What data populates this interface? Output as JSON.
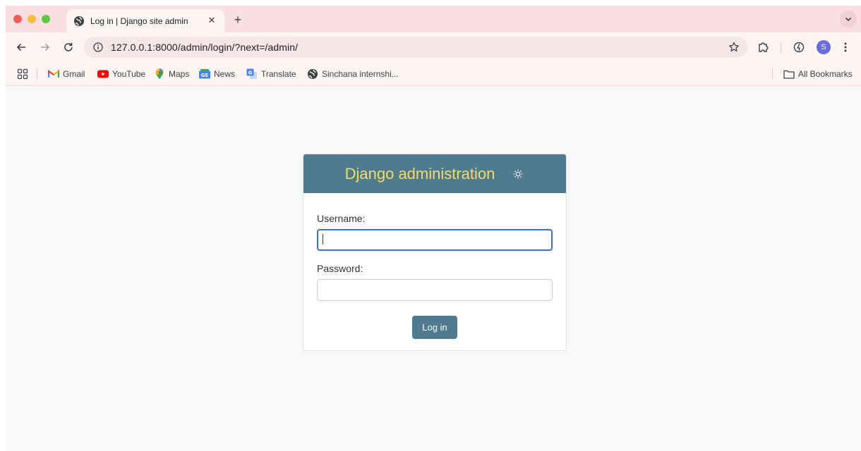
{
  "browser": {
    "tab": {
      "title": "Log in | Django site admin",
      "favicon": "globe-icon"
    },
    "new_tab_symbol": "+",
    "close_symbol": "✕",
    "url": "127.0.0.1:8000/admin/login/?next=/admin/",
    "profile_initial": "S",
    "colors": {
      "tabstrip": "#f9dee3",
      "toolbar": "#fdf4f4",
      "omnibox": "#f5e6e8",
      "avatar": "#6b6be0"
    }
  },
  "bookmarks": {
    "items": [
      {
        "label": "Gmail",
        "icon": "gmail-icon"
      },
      {
        "label": "YouTube",
        "icon": "youtube-icon"
      },
      {
        "label": "Maps",
        "icon": "maps-icon"
      },
      {
        "label": "News",
        "icon": "news-icon"
      },
      {
        "label": "Translate",
        "icon": "translate-icon"
      },
      {
        "label": "Sinchana internshi...",
        "icon": "globe-icon"
      }
    ],
    "all_bookmarks": "All Bookmarks"
  },
  "login": {
    "header_title": "Django administration",
    "username_label": "Username:",
    "username_value": "",
    "password_label": "Password:",
    "password_value": "",
    "submit_label": "Log in",
    "colors": {
      "header": "#4f7a8f",
      "title": "#f5dd5d",
      "button": "#4f7a8f",
      "focus_border": "#3b6fd3"
    }
  }
}
